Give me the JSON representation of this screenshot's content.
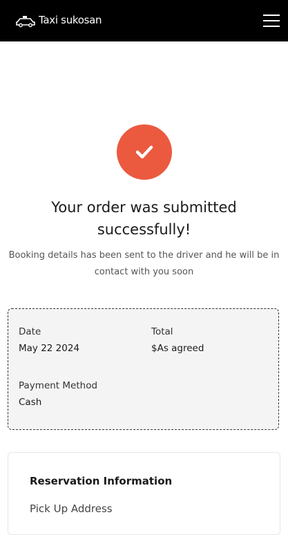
{
  "header": {
    "brand": "Taxi sukosan",
    "logo_icon": "taxi-car-icon",
    "menu_icon": "hamburger-menu-icon"
  },
  "confirmation": {
    "icon": "checkmark-icon",
    "accent_color": "#eb5a3f",
    "title": "Your order was submitted successfully!",
    "message": "Booking details has been sent to the driver and he will be in contact with you soon"
  },
  "summary": {
    "date_label": "Date",
    "date_value": "May 22 2024",
    "total_label": "Total",
    "total_value": "$As agreed",
    "payment_label": "Payment Method",
    "payment_value": "Cash"
  },
  "reservation": {
    "title": "Reservation Information",
    "pickup_label": "Pick Up Address"
  }
}
